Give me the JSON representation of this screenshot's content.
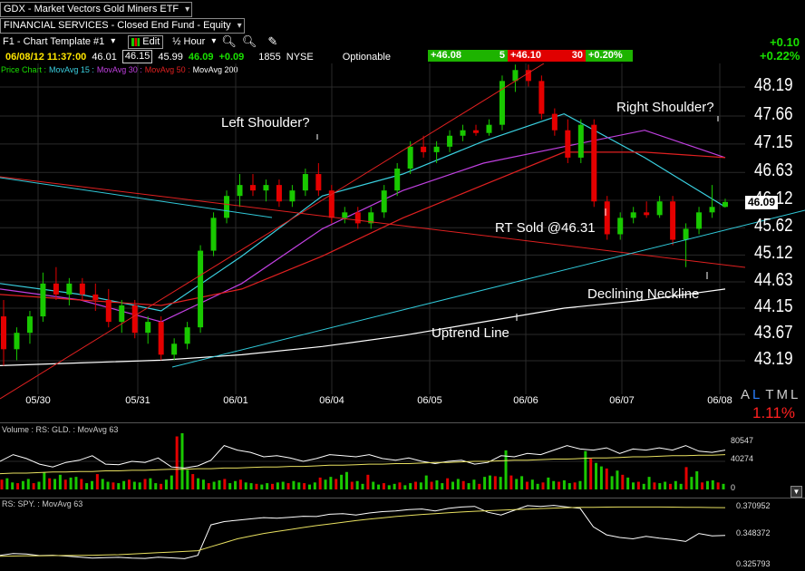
{
  "header": {
    "symbol_select": "GDX - Market Vectors Gold Miners ETF",
    "category_select": "FINANCIAL SERVICES - Closed End Fund - Equity",
    "template_select": "F1 - Chart Template #1",
    "edit_label": "Edit",
    "interval_select": "½ Hour",
    "change_abs": "+0.10",
    "change_pct": "+0.22%"
  },
  "quote": {
    "datetime": "06/08/12 11:37:00",
    "open": "46.01",
    "high": "46.15",
    "low": "45.99",
    "last": "46.09",
    "change": "+0.09",
    "volume": "1855",
    "exchange": "NYSE",
    "optionable": "Optionable",
    "bid": "+46.08",
    "bid_size": "5",
    "ask": "+46.10",
    "ask_size": "30",
    "ask_pct": "+0.20%"
  },
  "legend": {
    "price_chart": "Price Chart :",
    "ma15": "MovAvg 15 :",
    "ma30": "MovAvg 30 :",
    "ma50": "MovAvg 50 :",
    "ma200": "MovAvg 200",
    "volume_legend": "Volume : RS: GLD. : MovAvg 63",
    "rs_legend": "RS: SPY. : MovAvg 63"
  },
  "right_panel": {
    "a": "A",
    "l": "L",
    "t": "T",
    "m": "M",
    "l2": "L",
    "pct": "1.11%"
  },
  "colors": {
    "up": "#19c800",
    "down": "#e40000",
    "ma15": "#3ad0e0",
    "ma30": "#c040e0",
    "ma50": "#e02020",
    "ma200": "#ffffff",
    "trend": "#30c8d8",
    "resistance": "#e02020"
  },
  "chart_data": [
    {
      "type": "line",
      "title": "",
      "x": [
        "05/30",
        "05/31",
        "06/01",
        "06/04",
        "06/05",
        "06/06",
        "06/07",
        "06/08"
      ],
      "y_ticks": [
        48.19,
        47.66,
        47.15,
        46.63,
        46.12,
        45.62,
        45.12,
        44.63,
        44.15,
        43.67,
        43.19
      ],
      "ylim": [
        42.9,
        48.6
      ],
      "last_price_label": "46.09",
      "series": [
        {
          "name": "MovAvg 15",
          "values": [
            44.6,
            44.4,
            44.1,
            45.1,
            46.2,
            46.6,
            47.2,
            47.7,
            46.9,
            46.0
          ]
        },
        {
          "name": "MovAvg 30",
          "values": [
            44.5,
            44.3,
            43.9,
            44.6,
            45.6,
            46.3,
            46.8,
            47.1,
            47.4,
            46.9
          ]
        },
        {
          "name": "MovAvg 50",
          "values": [
            44.4,
            44.3,
            44.2,
            44.5,
            45.1,
            45.8,
            46.4,
            47.0,
            47.0,
            46.9
          ]
        },
        {
          "name": "MovAvg 200",
          "values": [
            43.1,
            43.15,
            43.2,
            43.3,
            43.45,
            43.65,
            43.9,
            44.15,
            44.3,
            44.5
          ]
        }
      ],
      "candles": [
        {
          "o": 44.0,
          "h": 44.3,
          "l": 43.1,
          "c": 43.4
        },
        {
          "o": 43.4,
          "h": 43.8,
          "l": 43.2,
          "c": 43.7
        },
        {
          "o": 43.7,
          "h": 44.1,
          "l": 43.5,
          "c": 44.0
        },
        {
          "o": 44.0,
          "h": 44.8,
          "l": 43.9,
          "c": 44.6
        },
        {
          "o": 44.6,
          "h": 44.9,
          "l": 44.3,
          "c": 44.4
        },
        {
          "o": 44.4,
          "h": 44.7,
          "l": 44.2,
          "c": 44.6
        },
        {
          "o": 44.6,
          "h": 44.7,
          "l": 44.3,
          "c": 44.4
        },
        {
          "o": 44.4,
          "h": 44.6,
          "l": 44.1,
          "c": 44.3
        },
        {
          "o": 44.3,
          "h": 44.5,
          "l": 43.8,
          "c": 43.9
        },
        {
          "o": 43.9,
          "h": 44.3,
          "l": 43.7,
          "c": 44.2
        },
        {
          "o": 44.2,
          "h": 44.3,
          "l": 43.6,
          "c": 43.7
        },
        {
          "o": 43.7,
          "h": 44.0,
          "l": 43.5,
          "c": 43.9
        },
        {
          "o": 43.9,
          "h": 44.0,
          "l": 43.2,
          "c": 43.3
        },
        {
          "o": 43.3,
          "h": 43.6,
          "l": 43.2,
          "c": 43.5
        },
        {
          "o": 43.5,
          "h": 43.9,
          "l": 43.4,
          "c": 43.8
        },
        {
          "o": 43.8,
          "h": 45.3,
          "l": 43.7,
          "c": 45.2
        },
        {
          "o": 45.2,
          "h": 45.9,
          "l": 45.1,
          "c": 45.8
        },
        {
          "o": 45.8,
          "h": 46.3,
          "l": 45.7,
          "c": 46.2
        },
        {
          "o": 46.2,
          "h": 46.6,
          "l": 46.0,
          "c": 46.4
        },
        {
          "o": 46.4,
          "h": 46.6,
          "l": 46.2,
          "c": 46.3
        },
        {
          "o": 46.3,
          "h": 46.5,
          "l": 46.1,
          "c": 46.4
        },
        {
          "o": 46.4,
          "h": 46.5,
          "l": 46.0,
          "c": 46.1
        },
        {
          "o": 46.1,
          "h": 46.4,
          "l": 46.0,
          "c": 46.3
        },
        {
          "o": 46.3,
          "h": 46.7,
          "l": 46.2,
          "c": 46.6
        },
        {
          "o": 46.6,
          "h": 46.8,
          "l": 46.2,
          "c": 46.3
        },
        {
          "o": 46.3,
          "h": 46.4,
          "l": 45.7,
          "c": 45.8
        },
        {
          "o": 45.8,
          "h": 46.0,
          "l": 45.7,
          "c": 45.9
        },
        {
          "o": 45.9,
          "h": 46.0,
          "l": 45.6,
          "c": 45.7
        },
        {
          "o": 45.7,
          "h": 46.0,
          "l": 45.6,
          "c": 45.9
        },
        {
          "o": 45.9,
          "h": 46.4,
          "l": 45.8,
          "c": 46.3
        },
        {
          "o": 46.3,
          "h": 46.8,
          "l": 46.2,
          "c": 46.7
        },
        {
          "o": 46.7,
          "h": 47.2,
          "l": 46.6,
          "c": 47.1
        },
        {
          "o": 47.1,
          "h": 47.3,
          "l": 46.9,
          "c": 47.0
        },
        {
          "o": 47.0,
          "h": 47.2,
          "l": 46.8,
          "c": 47.1
        },
        {
          "o": 47.1,
          "h": 47.4,
          "l": 47.0,
          "c": 47.3
        },
        {
          "o": 47.3,
          "h": 47.5,
          "l": 47.2,
          "c": 47.4
        },
        {
          "o": 47.4,
          "h": 47.5,
          "l": 47.3,
          "c": 47.35
        },
        {
          "o": 47.35,
          "h": 47.6,
          "l": 47.3,
          "c": 47.5
        },
        {
          "o": 47.5,
          "h": 48.4,
          "l": 47.4,
          "c": 48.3
        },
        {
          "o": 48.3,
          "h": 48.6,
          "l": 48.1,
          "c": 48.5
        },
        {
          "o": 48.5,
          "h": 48.6,
          "l": 48.2,
          "c": 48.3
        },
        {
          "o": 48.3,
          "h": 48.4,
          "l": 47.6,
          "c": 47.7
        },
        {
          "o": 47.7,
          "h": 47.8,
          "l": 47.3,
          "c": 47.4
        },
        {
          "o": 47.4,
          "h": 47.6,
          "l": 46.8,
          "c": 46.9
        },
        {
          "o": 46.9,
          "h": 47.6,
          "l": 46.8,
          "c": 47.5
        },
        {
          "o": 47.5,
          "h": 47.6,
          "l": 46.0,
          "c": 46.1
        },
        {
          "o": 46.1,
          "h": 46.2,
          "l": 45.4,
          "c": 45.5
        },
        {
          "o": 45.5,
          "h": 45.9,
          "l": 45.4,
          "c": 45.8
        },
        {
          "o": 45.8,
          "h": 46.0,
          "l": 45.7,
          "c": 45.9
        },
        {
          "o": 45.9,
          "h": 46.1,
          "l": 45.8,
          "c": 45.85
        },
        {
          "o": 45.85,
          "h": 46.2,
          "l": 45.8,
          "c": 46.1
        },
        {
          "o": 46.1,
          "h": 46.2,
          "l": 45.3,
          "c": 45.4
        },
        {
          "o": 45.4,
          "h": 45.7,
          "l": 44.9,
          "c": 45.6
        },
        {
          "o": 45.6,
          "h": 46.0,
          "l": 45.5,
          "c": 45.9
        },
        {
          "o": 45.9,
          "h": 46.4,
          "l": 45.8,
          "c": 46.0
        },
        {
          "o": 46.0,
          "h": 46.15,
          "l": 45.99,
          "c": 46.09
        }
      ],
      "annotations": [
        "Left Shoulder?",
        "Right Shoulder?",
        "RT Sold @46.31",
        "Declining Neckline",
        "Uptrend Line"
      ]
    },
    {
      "type": "bar",
      "title": "Volume : RS: GLD. : MovAvg 63",
      "y_ticks": [
        "80547",
        "40274",
        "0"
      ],
      "ylim": [
        0,
        80547
      ],
      "values": [
        14000,
        16000,
        10000,
        9000,
        12000,
        15000,
        9000,
        11000,
        24000,
        16000,
        15000,
        21000,
        14000,
        17000,
        18000,
        15000,
        9000,
        12000,
        22000,
        15000,
        11000,
        10000,
        9000,
        12000,
        14000,
        11000,
        10000,
        15000,
        16000,
        9000,
        8000,
        14000,
        20000,
        76000,
        80547,
        28000,
        22000,
        16000,
        14000,
        9000,
        11000,
        13000,
        15000,
        9000,
        12000,
        14000,
        10000,
        9000,
        8000,
        7000,
        9000,
        8000,
        10000,
        11000,
        9000,
        12000,
        10000,
        9000,
        7000,
        10000,
        17000,
        14000,
        18000,
        15000,
        21000,
        25000,
        11000,
        12000,
        8000,
        21000,
        11000,
        7000,
        9000,
        6000,
        8000,
        10000,
        6000,
        9000,
        11000,
        10000,
        20000,
        11000,
        13000,
        9000,
        16000,
        11000,
        15000,
        12000,
        9000,
        14000,
        8000,
        18000,
        20000,
        19000,
        18000,
        56000,
        20000,
        15000,
        19000,
        11000,
        14000,
        8000,
        10000,
        17000,
        12000,
        11000,
        13000,
        9000,
        10000,
        12000,
        55000,
        44000,
        38000,
        33000,
        30000,
        19000,
        27000,
        21000,
        17000,
        10000,
        11000,
        8000,
        18000,
        10000,
        9000,
        11000,
        8000,
        12000,
        8000,
        32000,
        18000,
        26000,
        10000,
        12000,
        13000,
        10000,
        8000
      ],
      "rs_gld": [
        50,
        62,
        55,
        45,
        40,
        48,
        52,
        60,
        45,
        44,
        50,
        48,
        56,
        40,
        38,
        42,
        52,
        78,
        70,
        66,
        58,
        60,
        56,
        50,
        55,
        62,
        60,
        58,
        62,
        55,
        52,
        56,
        50,
        46,
        50,
        52,
        45,
        48,
        60,
        58,
        64,
        62,
        70,
        78,
        72,
        70,
        74,
        64,
        72,
        70,
        74,
        70,
        78,
        68,
        66,
        70
      ],
      "ma63": [
        28,
        29,
        29,
        30,
        31,
        31,
        32,
        32,
        33,
        33,
        34,
        34,
        35,
        36,
        36,
        37,
        37,
        38,
        38,
        39,
        40,
        40,
        41,
        41,
        42,
        43,
        43,
        44,
        45,
        45,
        46,
        46,
        47,
        48,
        48,
        49,
        50,
        50,
        51,
        52,
        52,
        53,
        54,
        54,
        55,
        56,
        56,
        57,
        58,
        58,
        59,
        60,
        60,
        61,
        61,
        62
      ]
    },
    {
      "type": "line",
      "title": "RS: SPY. : MovAvg 63",
      "y_ticks": [
        0.370952,
        0.348372,
        0.325793
      ],
      "ylim": [
        0.325793,
        0.370952
      ],
      "series": [
        {
          "name": "RS: SPY.",
          "values": [
            0.3335,
            0.3348,
            0.3345,
            0.3333,
            0.3336,
            0.333,
            0.3322,
            0.3315,
            0.3318,
            0.332,
            0.3315,
            0.3312,
            0.3321,
            0.3316,
            0.331,
            0.3335,
            0.3565,
            0.359,
            0.36,
            0.361,
            0.362,
            0.3615,
            0.3622,
            0.363,
            0.3628,
            0.3645,
            0.365,
            0.364,
            0.3655,
            0.3665,
            0.367,
            0.368,
            0.3685,
            0.367,
            0.369,
            0.37,
            0.3705,
            0.366,
            0.364,
            0.3675,
            0.371,
            0.3705,
            0.3712,
            0.37,
            0.369,
            0.355,
            0.349,
            0.347,
            0.346,
            0.3478,
            0.3465,
            0.3455,
            0.344,
            0.35,
            0.3482,
            0.3485
          ]
        },
        {
          "name": "MovAvg 63",
          "values": [
            0.3328,
            0.333,
            0.3331,
            0.3332,
            0.3333,
            0.3334,
            0.3335,
            0.3336,
            0.3338,
            0.334,
            0.3345,
            0.335,
            0.3355,
            0.336,
            0.3365,
            0.337,
            0.34,
            0.343,
            0.346,
            0.348,
            0.35,
            0.3515,
            0.353,
            0.3545,
            0.356,
            0.3572,
            0.3585,
            0.3597,
            0.3608,
            0.3618,
            0.3628,
            0.3636,
            0.3644,
            0.365,
            0.3656,
            0.3662,
            0.3668,
            0.3672,
            0.3676,
            0.368,
            0.3684,
            0.3688,
            0.3692,
            0.3695,
            0.3697,
            0.3698,
            0.3699,
            0.37,
            0.37,
            0.37,
            0.37,
            0.3699,
            0.3698,
            0.3697,
            0.3696,
            0.3695
          ]
        }
      ]
    }
  ]
}
